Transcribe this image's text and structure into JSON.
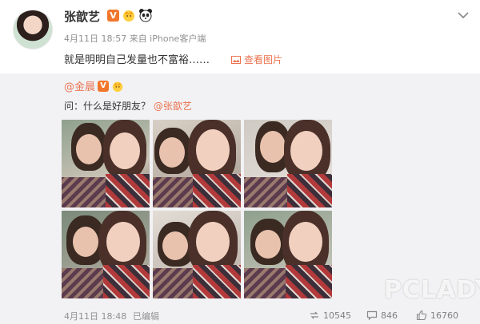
{
  "post": {
    "username": "张歆艺",
    "vip_badge": "V",
    "meta": "4月11日 18:57 来自 iPhone客户端",
    "text": "就是明明自己发量也不富裕……",
    "view_images_label": "查看图片"
  },
  "repost": {
    "author": "@金晨",
    "vip_badge": "V",
    "text_prefix": "问：什么是好朋友？ ",
    "mention": "@张歆艺",
    "photos": [
      {
        "label": "photo-1"
      },
      {
        "label": "photo-2"
      },
      {
        "label": "photo-3"
      },
      {
        "label": "photo-4"
      },
      {
        "label": "photo-5"
      },
      {
        "label": "photo-6"
      }
    ],
    "time": "4月11日 18:48",
    "edited": "已编辑",
    "reposts": "10545",
    "comments": "846",
    "likes": "16760"
  },
  "watermark": "PCLADY",
  "colors": {
    "accent": "#eb7350",
    "vip": "#f2762b",
    "repost_bg": "#f2f2f5",
    "meta_text": "#909090"
  },
  "icons": [
    "crown-icon",
    "panda-icon",
    "chevron-down-icon",
    "image-icon",
    "repost-icon",
    "comment-icon",
    "like-icon"
  ]
}
